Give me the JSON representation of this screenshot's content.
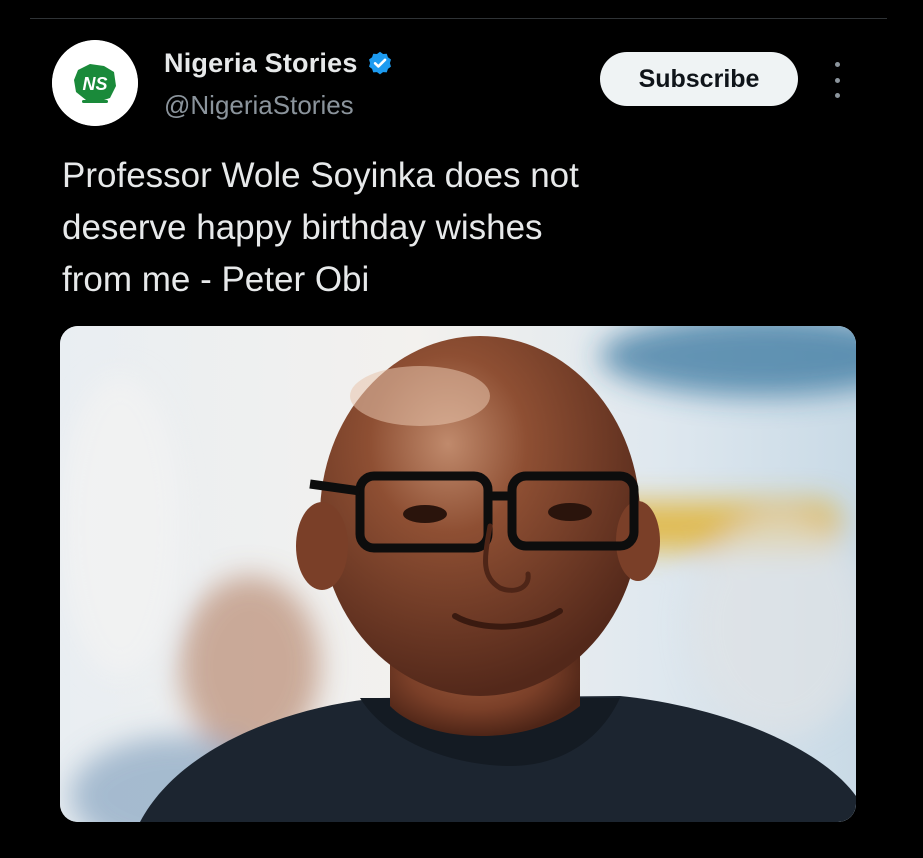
{
  "tweet": {
    "account": {
      "display_name": "Nigeria Stories",
      "handle": "@NigeriaStories",
      "verified": true,
      "avatar_label": "NS"
    },
    "actions": {
      "subscribe_label": "Subscribe"
    },
    "text_lines": [
      "Professor Wole Soyinka does not",
      "deserve happy birthday wishes",
      "from me - Peter Obi"
    ]
  },
  "colors": {
    "background": "#000000",
    "primary_text": "#e7e9ea",
    "secondary_text": "#8b949c",
    "verified_blue": "#1d9bf0",
    "button_bg": "#eff3f4",
    "button_text": "#0f1419",
    "logo_green": "#1a8a3a"
  },
  "icons": {
    "verified": "verified-badge-icon",
    "more": "more-options-icon"
  }
}
